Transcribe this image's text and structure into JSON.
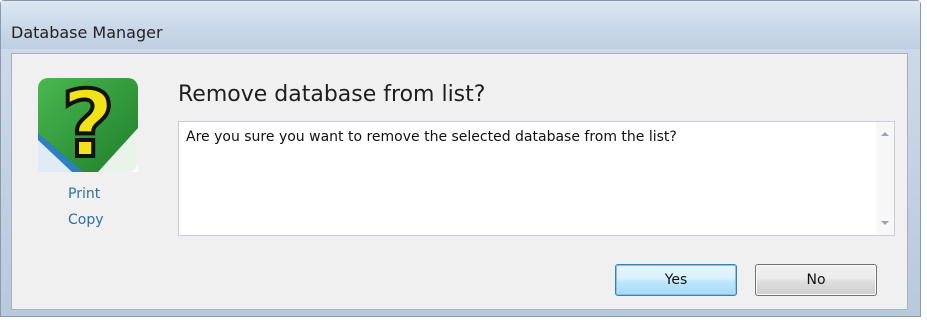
{
  "window": {
    "title": "Database Manager"
  },
  "sidebar": {
    "icon": "question-mark-icon",
    "print_label": "Print",
    "copy_label": "Copy"
  },
  "dialog": {
    "heading": "Remove database from list?",
    "message": "Are you sure you want to remove the selected database from the list?"
  },
  "buttons": {
    "yes_label": "Yes",
    "no_label": "No"
  },
  "colors": {
    "icon_yellow": "#f2e21a",
    "icon_green": "#2e9a3c",
    "icon_blue": "#2c7fc1",
    "link": "#2d6fa8"
  }
}
